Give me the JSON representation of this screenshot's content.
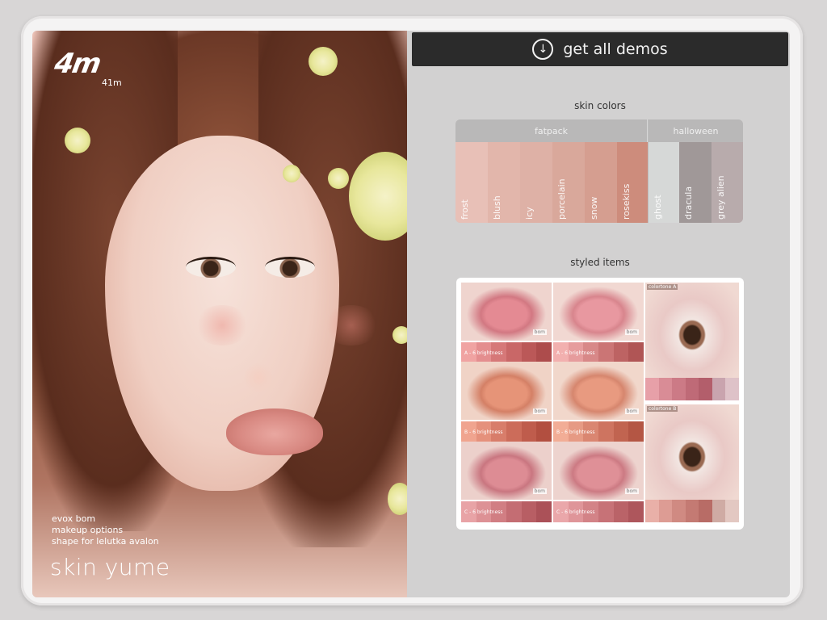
{
  "poster": {
    "logo_text": "4m",
    "logo_sub": "41m",
    "info_lines": [
      "evox bom",
      "makeup options",
      "shape for lelutka avalon"
    ],
    "title": "skin yume"
  },
  "demos_button": {
    "label": "get all demos",
    "icon": "download-circle-icon"
  },
  "skin_colors": {
    "title": "skin colors",
    "groups": [
      {
        "label": "fatpack",
        "swatches": [
          {
            "name": "frost",
            "color": "#e8c0b7"
          },
          {
            "name": "blush",
            "color": "#e2b6ab"
          },
          {
            "name": "icy",
            "color": "#deb1a6"
          },
          {
            "name": "porcelain",
            "color": "#d9a89b"
          },
          {
            "name": "snow",
            "color": "#d59e90"
          },
          {
            "name": "rosekiss",
            "color": "#cd8c7c"
          }
        ]
      },
      {
        "label": "halloween",
        "swatches": [
          {
            "name": "ghost",
            "color": "#d6d8d7"
          },
          {
            "name": "dracula",
            "color": "#a09898"
          },
          {
            "name": "grey alien",
            "color": "#b8abac"
          }
        ]
      }
    ]
  },
  "styled_items": {
    "title": "styled items",
    "lips": [
      {
        "label": "A - 6 brightness",
        "tag": "bom",
        "lip": "#e48a93",
        "lipd": "#d27882",
        "skin": "#efd4ce",
        "strip": [
          "#f0a3a2",
          "#e48e8f",
          "#d67878",
          "#c96767",
          "#bb5858",
          "#ad4c4c"
        ]
      },
      {
        "label": "A - 6 brightness",
        "tag": "bom",
        "lip": "#e898a0",
        "lipd": "#d8858d",
        "skin": "#f1d8d2",
        "strip": [
          "#f2b0af",
          "#e69c9d",
          "#d88888",
          "#cb7575",
          "#bd6363",
          "#b05555"
        ]
      },
      {
        "label": "B - 6 brightness",
        "tag": "bom",
        "lip": "#e69478",
        "lipd": "#d48066",
        "skin": "#f0d3c6",
        "strip": [
          "#f0a48f",
          "#e5917c",
          "#d87d6a",
          "#cc6c5a",
          "#bf5c4c",
          "#b24f40"
        ]
      },
      {
        "label": "B - 6 brightness",
        "tag": "bom",
        "lip": "#e89a80",
        "lipd": "#d6866e",
        "skin": "#f1d7cb",
        "strip": [
          "#f2ad96",
          "#e69a84",
          "#da8671",
          "#ce7460",
          "#c16450",
          "#b45644"
        ]
      },
      {
        "label": "C - 6 brightness",
        "tag": "bom",
        "lip": "#dd8c94",
        "lipd": "#c97680",
        "skin": "#ecd0cb",
        "strip": [
          "#e8a3a6",
          "#dd9195",
          "#d17e83",
          "#c46d73",
          "#b85e64",
          "#ab5158"
        ]
      },
      {
        "label": "C - 6 brightness",
        "tag": "bom",
        "lip": "#df9097",
        "lipd": "#cc7a83",
        "skin": "#edd3ce",
        "strip": [
          "#eaa7aa",
          "#df9599",
          "#d38387",
          "#c77277",
          "#ba6368",
          "#ae565c"
        ]
      }
    ],
    "eyes": [
      {
        "tone": "colortone A",
        "strip": [
          "#e7a0a8",
          "#d98c96",
          "#cc7a86",
          "#bf6a77",
          "#b35e6b",
          "#c9a4ae",
          "#dec2c8"
        ]
      },
      {
        "tone": "colortone B",
        "strip": [
          "#e9b0a8",
          "#dd9c94",
          "#d08a82",
          "#c47a73",
          "#b86c66",
          "#cfaba4",
          "#e3c8c2"
        ]
      }
    ]
  }
}
